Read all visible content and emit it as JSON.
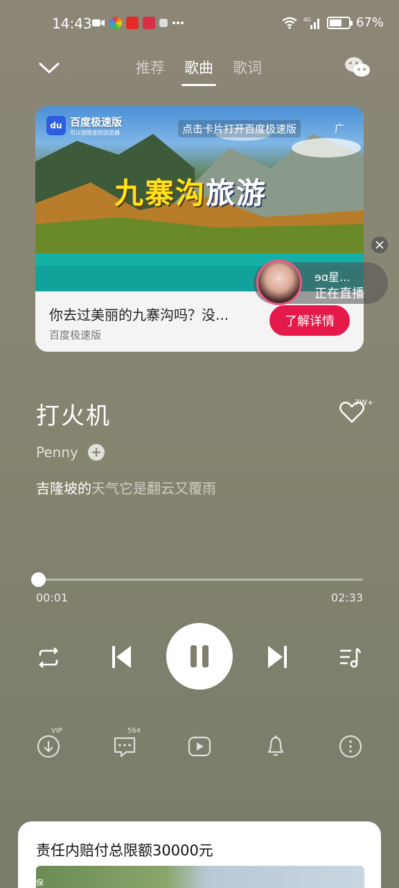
{
  "status_bar": {
    "time": "14:43",
    "battery_text": "67%",
    "battery_level": 0.67,
    "network": "4G"
  },
  "nav": {
    "tabs": [
      "推荐",
      "歌曲",
      "歌词"
    ],
    "active_tab": "歌曲"
  },
  "ad": {
    "brand_name": "百度极速版",
    "brand_sub": "可以领现金的浏览器",
    "hint": "点击卡片打开百度极速版",
    "label": "广",
    "title_yellow_1": "九寨",
    "title_yellow_2": "沟",
    "title_white": "旅游",
    "title_mid": "",
    "description": "你去过美丽的九寨沟吗？没...",
    "source": "百度极速版",
    "cta": "了解详情"
  },
  "live": {
    "name": "ɘɑ星...",
    "status": "正在直播"
  },
  "song": {
    "title": "打火机",
    "artist": "Penny",
    "like_count": "7W+",
    "lyric_sung": "吉隆坡的",
    "lyric_unsung": "天气它是翻云又覆雨"
  },
  "progress": {
    "current": "00:01",
    "total": "02:33",
    "fraction": 0.007
  },
  "actions": {
    "download_badge": "VIP",
    "comment_count": "564"
  },
  "bottom_ad": {
    "title": "责任内赔付总限额30000元",
    "brand": "蚂蚁保"
  },
  "colors": {
    "accent": "#e5194a",
    "live_ring": "#ec5a86"
  }
}
